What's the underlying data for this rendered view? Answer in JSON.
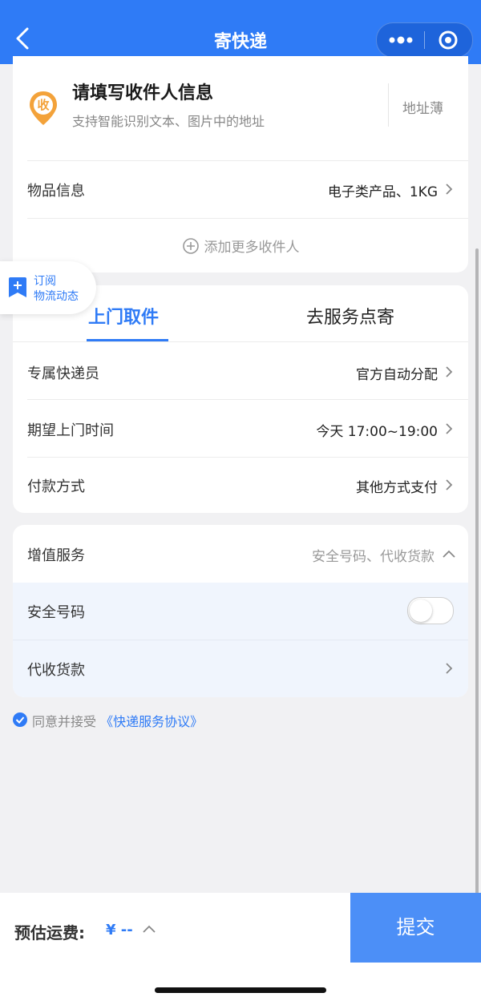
{
  "header": {
    "title": "寄快递",
    "bg_color": "#2f7bf6"
  },
  "receiver": {
    "badge": "收",
    "title": "请填写收件人信息",
    "subtitle": "支持智能识别文本、图片中的地址",
    "address_book": "地址薄"
  },
  "item_info": {
    "label": "物品信息",
    "value": "电子类产品、1KG"
  },
  "add_more": "添加更多收件人",
  "subscribe": {
    "line1": "订阅",
    "line2": "物流动态"
  },
  "tabs": [
    {
      "label": "上门取件",
      "active": true
    },
    {
      "label": "去服务点寄",
      "active": false
    }
  ],
  "pickup": {
    "courier": {
      "label": "专属快递员",
      "value": "官方自动分配"
    },
    "time": {
      "label": "期望上门时间",
      "value": "今天 17:00~19:00"
    },
    "payment": {
      "label": "付款方式",
      "value": "其他方式支付"
    }
  },
  "value_added": {
    "label": "增值服务",
    "value": "安全号码、代收货款",
    "items": [
      {
        "label": "安全号码",
        "toggle_on": false
      },
      {
        "label": "代收货款"
      }
    ]
  },
  "agreement": {
    "text": "同意并接受",
    "link": "《快递服务协议》",
    "checked": true
  },
  "bottom": {
    "fee_label": "预估运费:",
    "fee_value": "¥ -- ",
    "submit": "提交"
  },
  "colors": {
    "accent": "#2f7bf6",
    "orange": "#f3a23a",
    "background": "#f1f1f3"
  }
}
